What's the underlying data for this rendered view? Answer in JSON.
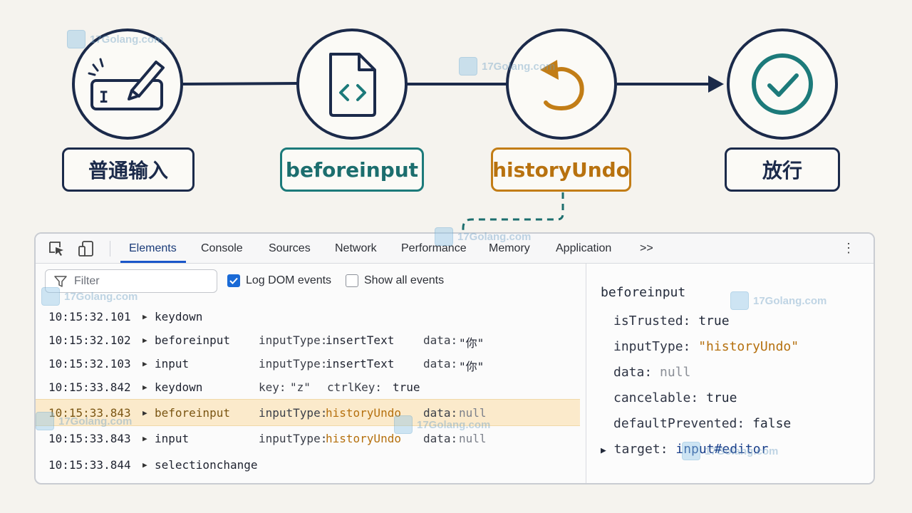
{
  "flow": {
    "steps": [
      {
        "label": "普通输入",
        "icon": "text-input-pencil-icon",
        "style": "navy"
      },
      {
        "label": "beforeinput",
        "icon": "code-file-icon",
        "style": "teal"
      },
      {
        "label": "historyUndo",
        "icon": "undo-arrow-icon",
        "style": "orange"
      },
      {
        "label": "放行",
        "icon": "check-circle-icon",
        "style": "navy"
      }
    ]
  },
  "colors": {
    "navy": "#1b2a4a",
    "teal": "#1c7a7a",
    "orange": "#c27d16",
    "highlight": "#fbeacb",
    "accent_blue": "#1a56c9"
  },
  "devtools": {
    "tabs": [
      "Elements",
      "Console",
      "Sources",
      "Network",
      "Performance",
      "Memory",
      "Application",
      ">>"
    ],
    "active_tab": "Elements",
    "filter_placeholder": "Filter",
    "log_dom_events": {
      "label": "Log DOM events",
      "checked": true
    },
    "show_all_events": {
      "label": "Show all events",
      "checked": false
    },
    "log_rows": [
      {
        "time": "10:15:32.101",
        "event": "keydown"
      },
      {
        "time": "10:15:32.102",
        "event": "beforeinput",
        "k1": "inputType:",
        "v1": "insertText",
        "k2": "data:",
        "v2": "\"你\""
      },
      {
        "time": "10:15:32.103",
        "event": "input",
        "k1": "inputType:",
        "v1": "insertText",
        "k2": "data:",
        "v2": "\"你\""
      },
      {
        "time": "10:15:33.842",
        "event": "keydown",
        "k1": "key:",
        "v1": "\"z\"",
        "k3": "ctrlKey:",
        "v3": "true"
      },
      {
        "time": "10:15:33.843",
        "event": "beforeinput",
        "k1": "inputType:",
        "v1": "historyUndo",
        "k2": "data:",
        "v2": "null",
        "highlighted": true
      },
      {
        "time": "10:15:33.843",
        "event": "input",
        "k1": "inputType:",
        "v1": "historyUndo",
        "k2": "data:",
        "v2": "null"
      },
      {
        "time": "10:15:33.844",
        "event": "selectionchange"
      }
    ],
    "details": {
      "title": "beforeinput",
      "props": [
        {
          "key": "isTrusted:",
          "value": "true"
        },
        {
          "key": "inputType:",
          "value": "\"historyUndo\""
        },
        {
          "key": "data:",
          "value": "null"
        },
        {
          "key": "cancelable:",
          "value": "true"
        },
        {
          "key": "defaultPrevented:",
          "value": "false"
        }
      ],
      "target": {
        "key": "target:",
        "value": "input#editor"
      }
    }
  },
  "watermark": {
    "text": "17Golang.com"
  }
}
